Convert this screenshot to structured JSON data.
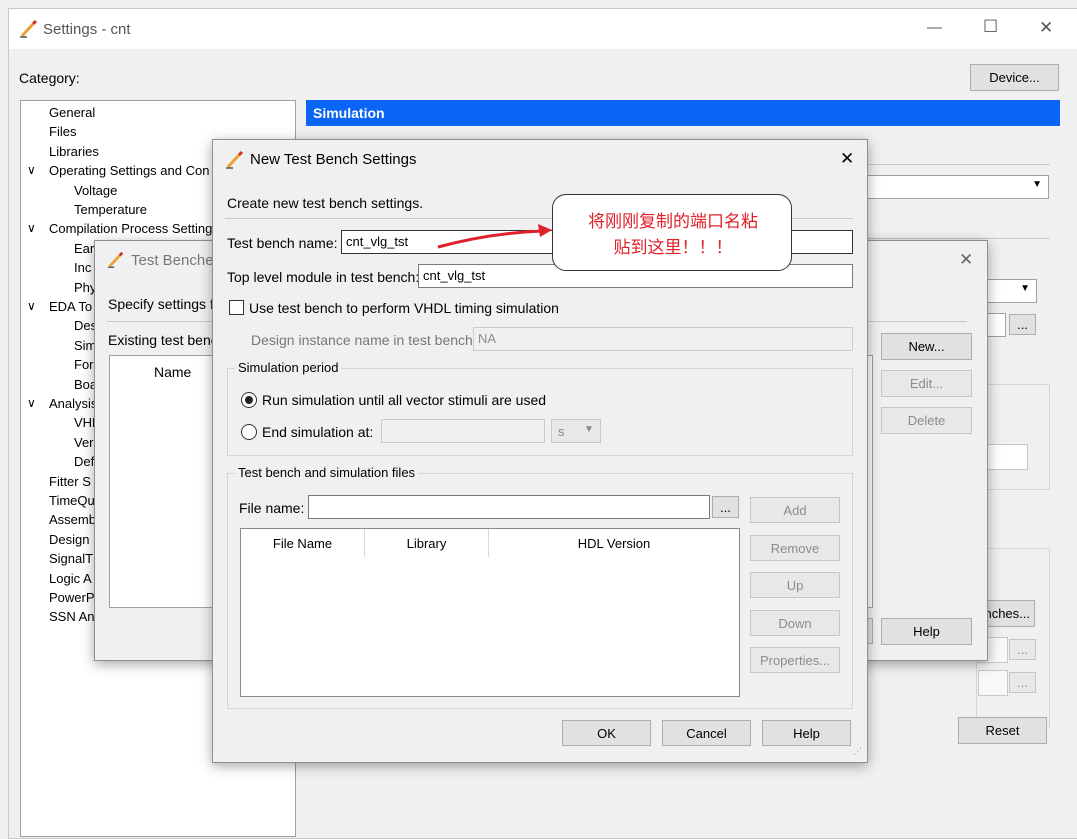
{
  "window": {
    "title": "Settings - cnt",
    "controls": {
      "minimize": "—",
      "maximize": "☐",
      "close": "✕"
    }
  },
  "main": {
    "category_label": "Category:",
    "device_button": "Device...",
    "panel_header": "Simulation",
    "reset_button": "Reset",
    "partial_button": "nches...",
    "help_button": "Help",
    "ellipsis": "..."
  },
  "tree": {
    "items": [
      {
        "label": "General",
        "indent": 0
      },
      {
        "label": "Files",
        "indent": 0
      },
      {
        "label": "Libraries",
        "indent": 0
      },
      {
        "label": "Operating Settings and Con",
        "indent": 0,
        "expander": "∨"
      },
      {
        "label": "Voltage",
        "indent": 1
      },
      {
        "label": "Temperature",
        "indent": 1
      },
      {
        "label": "Compilation Process Setting",
        "indent": 0,
        "expander": "∨"
      },
      {
        "label": "Ear",
        "indent": 1
      },
      {
        "label": "Inc",
        "indent": 1
      },
      {
        "label": "Phy",
        "indent": 1
      },
      {
        "label": "EDA To",
        "indent": 0,
        "expander": "∨"
      },
      {
        "label": "Des",
        "indent": 1
      },
      {
        "label": "Sim",
        "indent": 1,
        "selected": true
      },
      {
        "label": "For",
        "indent": 1
      },
      {
        "label": "Boa",
        "indent": 1
      },
      {
        "label": "Analysis",
        "indent": 0,
        "expander": "∨"
      },
      {
        "label": "VHD",
        "indent": 1
      },
      {
        "label": "Ver",
        "indent": 1
      },
      {
        "label": "Def",
        "indent": 1
      },
      {
        "label": "Fitter S",
        "indent": 0
      },
      {
        "label": "TimeQu",
        "indent": 0
      },
      {
        "label": "Assemb",
        "indent": 0
      },
      {
        "label": "Design",
        "indent": 0
      },
      {
        "label": "SignalT",
        "indent": 0
      },
      {
        "label": "Logic A",
        "indent": 0
      },
      {
        "label": "PowerP",
        "indent": 0
      },
      {
        "label": "SSN An",
        "indent": 0
      }
    ]
  },
  "mid_dialog": {
    "title": "Test Benche",
    "specify_text": "Specify settings fo",
    "existing_text": "Existing test bench",
    "name_column": "Name",
    "new_button": "New...",
    "edit_button": "Edit...",
    "delete_button": "Delete",
    "help_button": "Help"
  },
  "dialog": {
    "title": "New Test Bench Settings",
    "description": "Create new test bench settings.",
    "tb_name_label": "Test bench name:",
    "tb_name_value": "cnt_vlg_tst",
    "top_module_label": "Top level module in test bench:",
    "top_module_value": "cnt_vlg_tst",
    "vhdl_checkbox_label": "Use test bench to perform VHDL timing simulation",
    "instance_label": "Design instance name in test bench:",
    "instance_value": "NA",
    "sim_period_title": "Simulation period",
    "run_radio_label": "Run simulation until all vector stimuli are used",
    "end_radio_label": "End simulation at:",
    "time_unit": "s",
    "files_group_title": "Test bench and simulation files",
    "file_name_label": "File name:",
    "file_name_value": "",
    "browse_label": "...",
    "columns": [
      "File Name",
      "Library",
      "HDL Version"
    ],
    "add_button": "Add",
    "remove_button": "Remove",
    "up_button": "Up",
    "down_button": "Down",
    "properties_button": "Properties...",
    "ok_button": "OK",
    "cancel_button": "Cancel",
    "help_button": "Help",
    "close_glyph": "✕"
  },
  "callout": {
    "text_line1": "将刚刚复制的端口名粘",
    "text_line2": "贴到这里！！！"
  },
  "colors": {
    "header_blue": "#0a64f5",
    "annotation_red": "#e0202a"
  }
}
